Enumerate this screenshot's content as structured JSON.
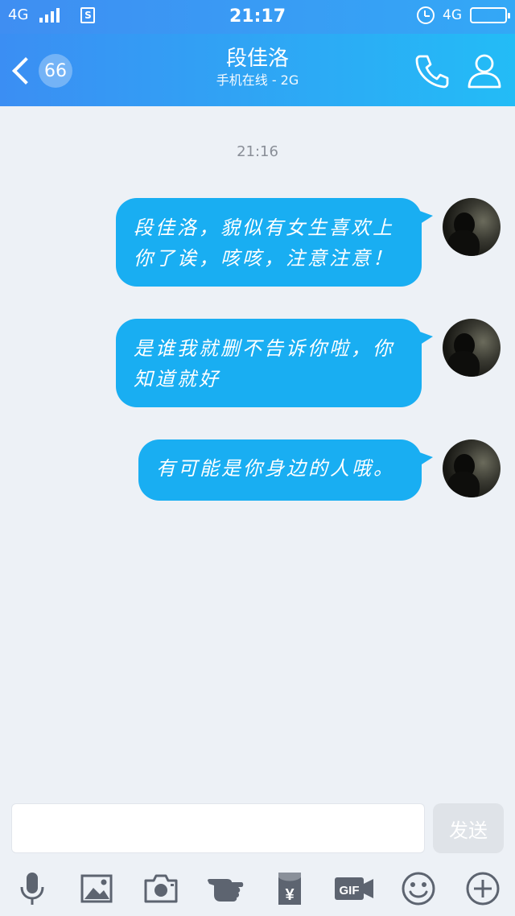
{
  "status_bar": {
    "network_left": "4G",
    "sim_label": "S",
    "time": "21:17",
    "network_right": "4G"
  },
  "header": {
    "back_badge": "66",
    "title": "段佳洛",
    "subtitle": "手机在线 - 2G",
    "icons": [
      "back-icon",
      "phone-icon",
      "profile-icon"
    ]
  },
  "chat": {
    "timestamp": "21:16",
    "messages": [
      {
        "line1": "段佳洛，貌似有女生喜欢上",
        "line2": "你了诶，咳咳，注意注意！"
      },
      {
        "line1": "是谁我就删不告诉你啦，你",
        "line2": "知道就好"
      },
      {
        "line1": "有可能是你身边的人哦。",
        "line2": ""
      }
    ]
  },
  "input": {
    "value": "",
    "send_label": "发送"
  },
  "toolbar": {
    "icons": [
      "microphone-icon",
      "image-icon",
      "camera-icon",
      "poke-hand-icon",
      "red-packet-icon",
      "gif-icon",
      "emoji-icon",
      "plus-icon"
    ],
    "gif_label": "GIF",
    "red_packet_label": "¥"
  },
  "colors": {
    "header_start": "#3b8ef3",
    "header_end": "#23bcf6",
    "bubble": "#19aef2",
    "background": "#edf1f6",
    "toolbar_icon": "#5d6470"
  }
}
